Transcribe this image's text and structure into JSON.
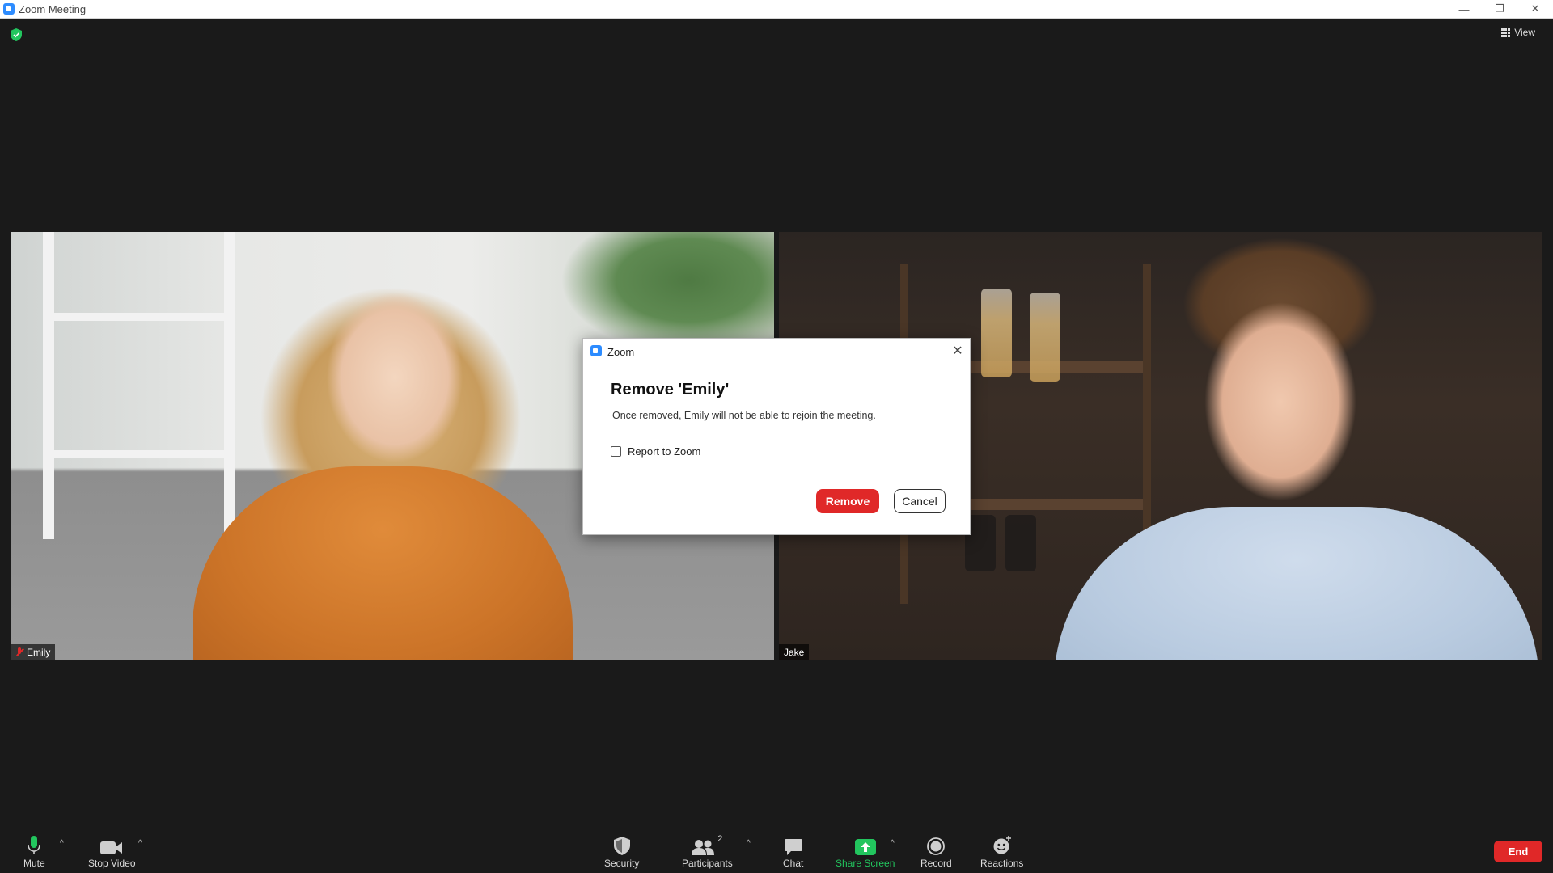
{
  "window": {
    "title": "Zoom Meeting",
    "controls": {
      "minimize": "—",
      "maximize": "❐",
      "close": "✕"
    }
  },
  "top_bar": {
    "view_label": "View"
  },
  "tiles": [
    {
      "name": "Emily",
      "muted": true
    },
    {
      "name": "Jake",
      "muted": false
    }
  ],
  "dialog": {
    "app_name": "Zoom",
    "title": "Remove 'Emily'",
    "message": "Once removed, Emily will not be able to rejoin the meeting.",
    "checkbox_label": "Report to Zoom",
    "checkbox_checked": false,
    "remove_label": "Remove",
    "cancel_label": "Cancel",
    "close_glyph": "✕"
  },
  "toolbar": {
    "mute": "Mute",
    "stop_video": "Stop Video",
    "security": "Security",
    "participants": "Participants",
    "participant_count": "2",
    "chat": "Chat",
    "share_screen": "Share Screen",
    "record": "Record",
    "reactions": "Reactions",
    "end": "End",
    "caret": "^"
  },
  "colors": {
    "accent_red": "#e02828",
    "share_green": "#22c55e",
    "zoom_blue": "#2d8cff",
    "background": "#1a1a1a"
  }
}
